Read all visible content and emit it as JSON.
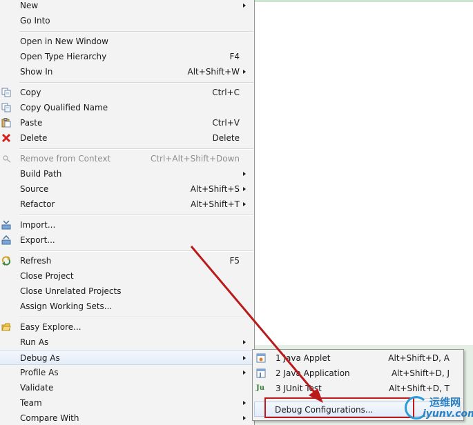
{
  "menu": {
    "items": [
      {
        "id": "new",
        "label": "New",
        "shortcut": "",
        "submenu": true,
        "icon": "",
        "disabled": false,
        "highlight": false
      },
      {
        "id": "go-into",
        "label": "Go Into",
        "shortcut": "",
        "submenu": false,
        "icon": "",
        "disabled": false,
        "highlight": false
      },
      {
        "id": "open-new-window",
        "label": "Open in New Window",
        "shortcut": "",
        "submenu": false,
        "icon": "",
        "disabled": false,
        "highlight": false
      },
      {
        "id": "open-type-hierarchy",
        "label": "Open Type Hierarchy",
        "shortcut": "F4",
        "submenu": false,
        "icon": "",
        "disabled": false,
        "highlight": false
      },
      {
        "id": "show-in",
        "label": "Show In",
        "shortcut": "Alt+Shift+W",
        "submenu": true,
        "icon": "",
        "disabled": false,
        "highlight": false
      },
      {
        "id": "copy",
        "label": "Copy",
        "shortcut": "Ctrl+C",
        "submenu": false,
        "icon": "copy-icon",
        "disabled": false,
        "highlight": false
      },
      {
        "id": "copy-qualified-name",
        "label": "Copy Qualified Name",
        "shortcut": "",
        "submenu": false,
        "icon": "copy-qualified-icon",
        "disabled": false,
        "highlight": false
      },
      {
        "id": "paste",
        "label": "Paste",
        "shortcut": "Ctrl+V",
        "submenu": false,
        "icon": "paste-icon",
        "disabled": false,
        "highlight": false
      },
      {
        "id": "delete",
        "label": "Delete",
        "shortcut": "Delete",
        "submenu": false,
        "icon": "delete-icon",
        "disabled": false,
        "highlight": false
      },
      {
        "id": "remove-from-context",
        "label": "Remove from Context",
        "shortcut": "Ctrl+Alt+Shift+Down",
        "submenu": false,
        "icon": "remove-context-icon",
        "disabled": true,
        "highlight": false
      },
      {
        "id": "build-path",
        "label": "Build Path",
        "shortcut": "",
        "submenu": true,
        "icon": "",
        "disabled": false,
        "highlight": false
      },
      {
        "id": "source",
        "label": "Source",
        "shortcut": "Alt+Shift+S",
        "submenu": true,
        "icon": "",
        "disabled": false,
        "highlight": false
      },
      {
        "id": "refactor",
        "label": "Refactor",
        "shortcut": "Alt+Shift+T",
        "submenu": true,
        "icon": "",
        "disabled": false,
        "highlight": false
      },
      {
        "id": "import",
        "label": "Import...",
        "shortcut": "",
        "submenu": false,
        "icon": "import-icon",
        "disabled": false,
        "highlight": false
      },
      {
        "id": "export",
        "label": "Export...",
        "shortcut": "",
        "submenu": false,
        "icon": "export-icon",
        "disabled": false,
        "highlight": false
      },
      {
        "id": "refresh",
        "label": "Refresh",
        "shortcut": "F5",
        "submenu": false,
        "icon": "refresh-icon",
        "disabled": false,
        "highlight": false
      },
      {
        "id": "close-project",
        "label": "Close Project",
        "shortcut": "",
        "submenu": false,
        "icon": "",
        "disabled": false,
        "highlight": false
      },
      {
        "id": "close-unrelated-projects",
        "label": "Close Unrelated Projects",
        "shortcut": "",
        "submenu": false,
        "icon": "",
        "disabled": false,
        "highlight": false
      },
      {
        "id": "assign-working-sets",
        "label": "Assign Working Sets...",
        "shortcut": "",
        "submenu": false,
        "icon": "",
        "disabled": false,
        "highlight": false
      },
      {
        "id": "easy-explore",
        "label": "Easy Explore...",
        "shortcut": "",
        "submenu": false,
        "icon": "folder-icon",
        "disabled": false,
        "highlight": false
      },
      {
        "id": "run-as",
        "label": "Run As",
        "shortcut": "",
        "submenu": true,
        "icon": "",
        "disabled": false,
        "highlight": false
      },
      {
        "id": "debug-as",
        "label": "Debug As",
        "shortcut": "",
        "submenu": true,
        "icon": "",
        "disabled": false,
        "highlight": true
      },
      {
        "id": "profile-as",
        "label": "Profile As",
        "shortcut": "",
        "submenu": true,
        "icon": "",
        "disabled": false,
        "highlight": false
      },
      {
        "id": "validate",
        "label": "Validate",
        "shortcut": "",
        "submenu": false,
        "icon": "",
        "disabled": false,
        "highlight": false
      },
      {
        "id": "team",
        "label": "Team",
        "shortcut": "",
        "submenu": true,
        "icon": "",
        "disabled": false,
        "highlight": false
      },
      {
        "id": "compare-with",
        "label": "Compare With",
        "shortcut": "",
        "submenu": true,
        "icon": "",
        "disabled": false,
        "highlight": false
      }
    ]
  },
  "submenu": {
    "items": [
      {
        "id": "java-applet",
        "label": "1 Java Applet",
        "shortcut": "Alt+Shift+D, A",
        "icon": "java-applet-icon"
      },
      {
        "id": "java-application",
        "label": "2 Java Application",
        "shortcut": "Alt+Shift+D, J",
        "icon": "java-application-icon"
      },
      {
        "id": "junit-test",
        "label": "3 JUnit Test",
        "shortcut": "Alt+Shift+D, T",
        "icon": "junit-icon",
        "icon_text": "Ju"
      },
      {
        "id": "debug-configurations",
        "label": "Debug Configurations...",
        "shortcut": "",
        "icon": ""
      }
    ]
  },
  "watermark": {
    "cn": "运维网",
    "en": "iyunv.com"
  },
  "colors": {
    "accent_red": "#c0181b",
    "menu_bg": "#f3f3f3",
    "highlight": "#e3ecf8",
    "watermark_blue": "#2a7fc0"
  }
}
